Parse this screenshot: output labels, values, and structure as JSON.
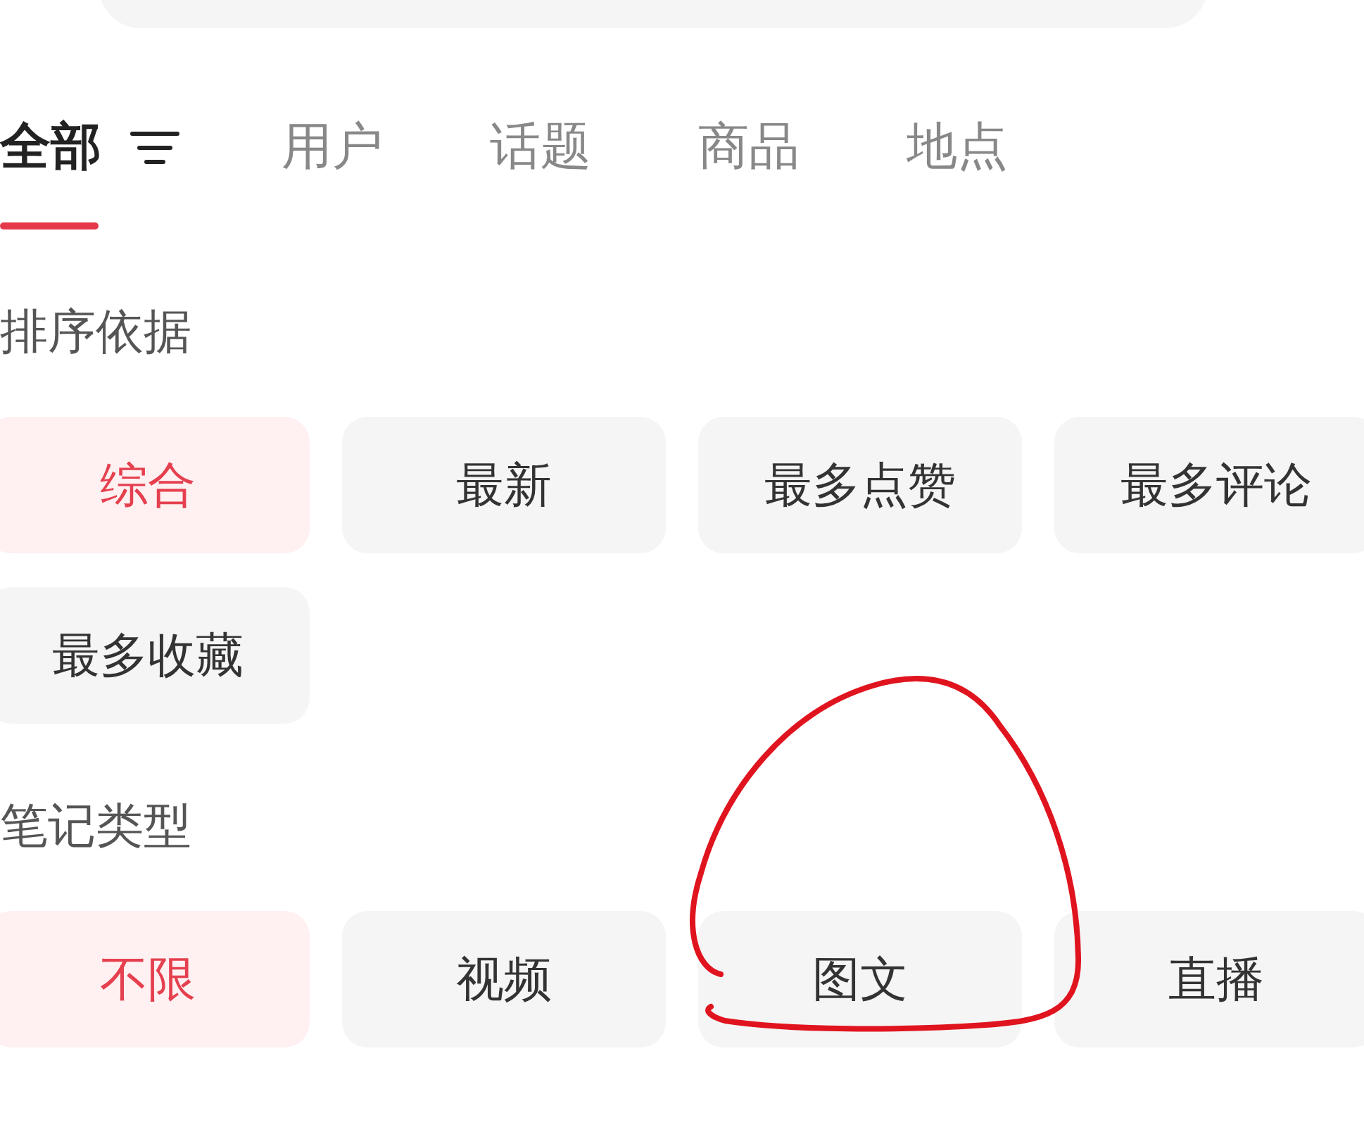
{
  "tabs": [
    {
      "label": "全部",
      "selected": true
    },
    {
      "label": "用户",
      "selected": false
    },
    {
      "label": "话题",
      "selected": false
    },
    {
      "label": "商品",
      "selected": false
    },
    {
      "label": "地点",
      "selected": false
    }
  ],
  "sections": [
    {
      "title": "排序依据",
      "options": [
        {
          "label": "综合",
          "selected": true
        },
        {
          "label": "最新",
          "selected": false
        },
        {
          "label": "最多点赞",
          "selected": false
        },
        {
          "label": "最多评论",
          "selected": false
        },
        {
          "label": "最多收藏",
          "selected": false
        }
      ]
    },
    {
      "title": "笔记类型",
      "options": [
        {
          "label": "不限",
          "selected": true
        },
        {
          "label": "视频",
          "selected": false
        },
        {
          "label": "图文",
          "selected": false
        },
        {
          "label": "直播",
          "selected": false
        }
      ]
    }
  ]
}
